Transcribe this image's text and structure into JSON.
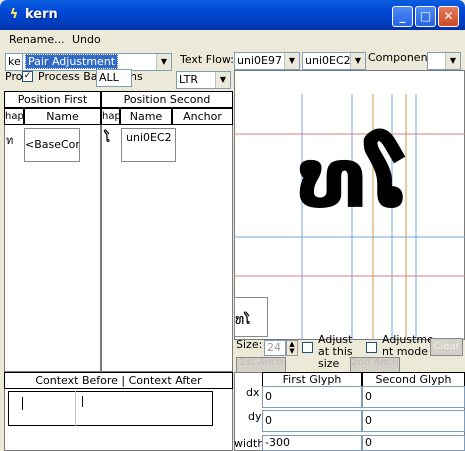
{
  "window": {
    "title": "kern",
    "minimize": "_",
    "maximize": "□",
    "close": "✕"
  },
  "menu": {
    "rename": "Rename...",
    "undo": "Undo"
  },
  "toolbar": {
    "subtable_prefix": "ke",
    "subtable_value": "Pair Adjustment",
    "process_prefix": "Pro",
    "process_label": "Process Ba",
    "process_suffix": "ns",
    "script_value": "ALL",
    "text_flow_label": "Text Flow:",
    "text_flow_value": "LTR",
    "first_glyph_value": "uni0E97",
    "second_glyph_value": "uni0EC2",
    "component_label": "Component:"
  },
  "left_table": {
    "title": "Position First",
    "col_shape": "hap",
    "col_name": "Name",
    "row_shape": "ท",
    "row_name": "<BaseCon"
  },
  "right_table": {
    "title": "Position Second",
    "col_shape": "hap",
    "col_name": "Name",
    "col_anchor": "Anchor",
    "row_shape": "ໂ",
    "row_name": "uni0EC2"
  },
  "context": {
    "title": "Context Before | Context After"
  },
  "preview": {
    "glyph_text": "ທໂ",
    "thumb_text": "ທໂ"
  },
  "controls": {
    "size_label": "Size:",
    "size_value": "24",
    "adjust_label": "Adjust at this size",
    "adjustment_mode_label": "Adjustme nt mode",
    "clear": "Clear",
    "first_anchor": "1st Anch",
    "second_anchor": "2nd Anch"
  },
  "metrics": {
    "first_glyph_header": "First Glyph",
    "second_glyph_header": "Second Glyph",
    "dx_label": "dx",
    "dy_label": "dy",
    "width_label": "width",
    "dx_first": "0",
    "dx_second": "0",
    "dy_first": "0",
    "dy_second": "0",
    "width_first": "-300",
    "width_second": "0"
  }
}
